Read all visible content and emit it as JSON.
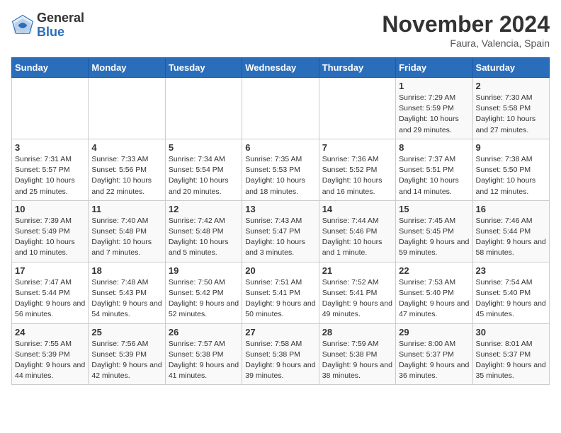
{
  "logo": {
    "general": "General",
    "blue": "Blue"
  },
  "header": {
    "month": "November 2024",
    "location": "Faura, Valencia, Spain"
  },
  "weekdays": [
    "Sunday",
    "Monday",
    "Tuesday",
    "Wednesday",
    "Thursday",
    "Friday",
    "Saturday"
  ],
  "weeks": [
    [
      {
        "day": "",
        "info": ""
      },
      {
        "day": "",
        "info": ""
      },
      {
        "day": "",
        "info": ""
      },
      {
        "day": "",
        "info": ""
      },
      {
        "day": "",
        "info": ""
      },
      {
        "day": "1",
        "info": "Sunrise: 7:29 AM\nSunset: 5:59 PM\nDaylight: 10 hours and 29 minutes."
      },
      {
        "day": "2",
        "info": "Sunrise: 7:30 AM\nSunset: 5:58 PM\nDaylight: 10 hours and 27 minutes."
      }
    ],
    [
      {
        "day": "3",
        "info": "Sunrise: 7:31 AM\nSunset: 5:57 PM\nDaylight: 10 hours and 25 minutes."
      },
      {
        "day": "4",
        "info": "Sunrise: 7:33 AM\nSunset: 5:56 PM\nDaylight: 10 hours and 22 minutes."
      },
      {
        "day": "5",
        "info": "Sunrise: 7:34 AM\nSunset: 5:54 PM\nDaylight: 10 hours and 20 minutes."
      },
      {
        "day": "6",
        "info": "Sunrise: 7:35 AM\nSunset: 5:53 PM\nDaylight: 10 hours and 18 minutes."
      },
      {
        "day": "7",
        "info": "Sunrise: 7:36 AM\nSunset: 5:52 PM\nDaylight: 10 hours and 16 minutes."
      },
      {
        "day": "8",
        "info": "Sunrise: 7:37 AM\nSunset: 5:51 PM\nDaylight: 10 hours and 14 minutes."
      },
      {
        "day": "9",
        "info": "Sunrise: 7:38 AM\nSunset: 5:50 PM\nDaylight: 10 hours and 12 minutes."
      }
    ],
    [
      {
        "day": "10",
        "info": "Sunrise: 7:39 AM\nSunset: 5:49 PM\nDaylight: 10 hours and 10 minutes."
      },
      {
        "day": "11",
        "info": "Sunrise: 7:40 AM\nSunset: 5:48 PM\nDaylight: 10 hours and 7 minutes."
      },
      {
        "day": "12",
        "info": "Sunrise: 7:42 AM\nSunset: 5:48 PM\nDaylight: 10 hours and 5 minutes."
      },
      {
        "day": "13",
        "info": "Sunrise: 7:43 AM\nSunset: 5:47 PM\nDaylight: 10 hours and 3 minutes."
      },
      {
        "day": "14",
        "info": "Sunrise: 7:44 AM\nSunset: 5:46 PM\nDaylight: 10 hours and 1 minute."
      },
      {
        "day": "15",
        "info": "Sunrise: 7:45 AM\nSunset: 5:45 PM\nDaylight: 9 hours and 59 minutes."
      },
      {
        "day": "16",
        "info": "Sunrise: 7:46 AM\nSunset: 5:44 PM\nDaylight: 9 hours and 58 minutes."
      }
    ],
    [
      {
        "day": "17",
        "info": "Sunrise: 7:47 AM\nSunset: 5:44 PM\nDaylight: 9 hours and 56 minutes."
      },
      {
        "day": "18",
        "info": "Sunrise: 7:48 AM\nSunset: 5:43 PM\nDaylight: 9 hours and 54 minutes."
      },
      {
        "day": "19",
        "info": "Sunrise: 7:50 AM\nSunset: 5:42 PM\nDaylight: 9 hours and 52 minutes."
      },
      {
        "day": "20",
        "info": "Sunrise: 7:51 AM\nSunset: 5:41 PM\nDaylight: 9 hours and 50 minutes."
      },
      {
        "day": "21",
        "info": "Sunrise: 7:52 AM\nSunset: 5:41 PM\nDaylight: 9 hours and 49 minutes."
      },
      {
        "day": "22",
        "info": "Sunrise: 7:53 AM\nSunset: 5:40 PM\nDaylight: 9 hours and 47 minutes."
      },
      {
        "day": "23",
        "info": "Sunrise: 7:54 AM\nSunset: 5:40 PM\nDaylight: 9 hours and 45 minutes."
      }
    ],
    [
      {
        "day": "24",
        "info": "Sunrise: 7:55 AM\nSunset: 5:39 PM\nDaylight: 9 hours and 44 minutes."
      },
      {
        "day": "25",
        "info": "Sunrise: 7:56 AM\nSunset: 5:39 PM\nDaylight: 9 hours and 42 minutes."
      },
      {
        "day": "26",
        "info": "Sunrise: 7:57 AM\nSunset: 5:38 PM\nDaylight: 9 hours and 41 minutes."
      },
      {
        "day": "27",
        "info": "Sunrise: 7:58 AM\nSunset: 5:38 PM\nDaylight: 9 hours and 39 minutes."
      },
      {
        "day": "28",
        "info": "Sunrise: 7:59 AM\nSunset: 5:38 PM\nDaylight: 9 hours and 38 minutes."
      },
      {
        "day": "29",
        "info": "Sunrise: 8:00 AM\nSunset: 5:37 PM\nDaylight: 9 hours and 36 minutes."
      },
      {
        "day": "30",
        "info": "Sunrise: 8:01 AM\nSunset: 5:37 PM\nDaylight: 9 hours and 35 minutes."
      }
    ]
  ]
}
